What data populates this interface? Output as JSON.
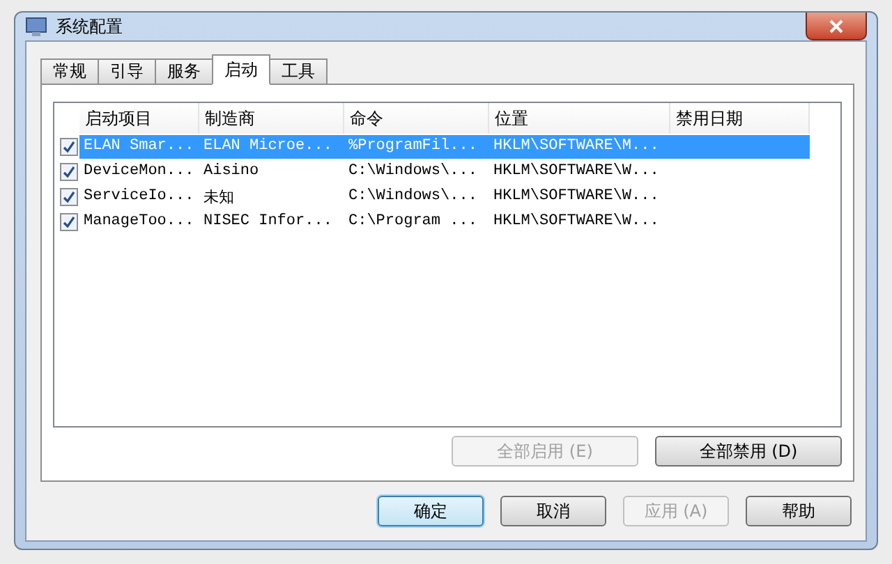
{
  "window": {
    "title": "系统配置"
  },
  "tabs": [
    {
      "label": "常规",
      "selected": false
    },
    {
      "label": "引导",
      "selected": false
    },
    {
      "label": "服务",
      "selected": false
    },
    {
      "label": "启动",
      "selected": true
    },
    {
      "label": "工具",
      "selected": false
    }
  ],
  "table": {
    "columns": [
      "启动项目",
      "制造商",
      "命令",
      "位置",
      "禁用日期"
    ],
    "rows": [
      {
        "checked": true,
        "selected": true,
        "cells": [
          "ELAN Smar...",
          "ELAN Microe...",
          "%ProgramFil...",
          "HKLM\\SOFTWARE\\M...",
          ""
        ]
      },
      {
        "checked": true,
        "selected": false,
        "cells": [
          "DeviceMon...",
          "Aisino",
          "C:\\Windows\\...",
          "HKLM\\SOFTWARE\\W...",
          ""
        ]
      },
      {
        "checked": true,
        "selected": false,
        "cells": [
          "ServiceIo...",
          "未知",
          "C:\\Windows\\...",
          "HKLM\\SOFTWARE\\W...",
          ""
        ]
      },
      {
        "checked": true,
        "selected": false,
        "cells": [
          "ManageToo...",
          "NISEC Infor...",
          "C:\\Program ...",
          "HKLM\\SOFTWARE\\W...",
          ""
        ]
      }
    ]
  },
  "panel_buttons": [
    {
      "label": "全部启用 (E)",
      "disabled": true
    },
    {
      "label": "全部禁用 (D)",
      "disabled": false
    }
  ],
  "dialog_buttons": [
    {
      "label": "确定",
      "disabled": false,
      "default": true
    },
    {
      "label": "取消",
      "disabled": false,
      "default": false
    },
    {
      "label": "应用 (A)",
      "disabled": true,
      "default": false
    },
    {
      "label": "帮助",
      "disabled": false,
      "default": false
    }
  ]
}
